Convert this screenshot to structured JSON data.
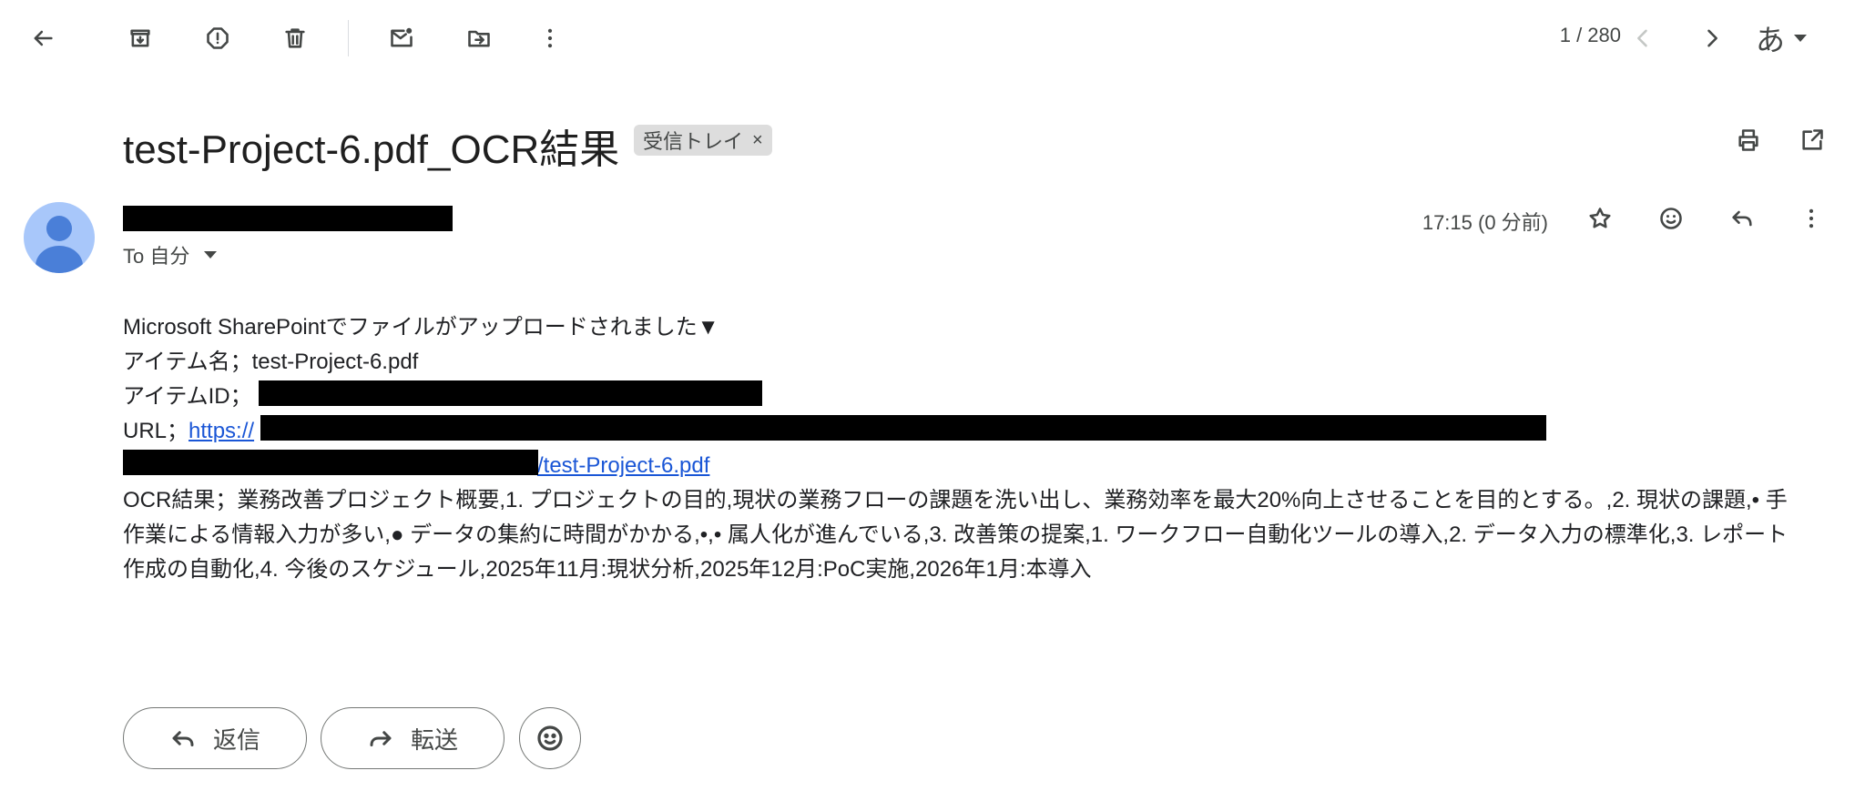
{
  "toolbar": {
    "icons": [
      "back-arrow-icon",
      "archive-icon",
      "report-spam-icon",
      "delete-icon",
      "mark-unread-icon",
      "move-to-icon",
      "more-vert-icon"
    ],
    "pager_text": "1 / 280",
    "lang_label": "あ"
  },
  "email": {
    "subject": "test-Project-6.pdf_OCR結果",
    "label_chip": "受信トレイ",
    "label_chip_remove": "×",
    "to_text": "To 自分",
    "time_text": "17:15 (0 分前)",
    "body": {
      "line1": "Microsoft SharePointでファイルがアップロードされました▼",
      "line2": "アイテム名；test-Project-6.pdf",
      "line3_label": "アイテムID；",
      "line4_label": "URL；",
      "line4_link": "https://",
      "line5_link": "/test-Project-6.pdf",
      "ocr": "OCR結果；業務改善プロジェクト概要,1. プロジェクトの目的,現状の業務フローの課題を洗い出し、業務効率を最大20%向上させることを目的とする。,2. 現状の課題,• 手作業による情報入力が多い,● データの集約に時間がかかる,•,• 属人化が進んでいる,3. 改善策の提案,1. ワークフロー自動化ツールの導入,2. データ入力の標準化,3. レポート作成の自動化,4. 今後のスケジュール,2025年11月:現状分析,2025年12月:PoC実施,2026年1月:本導入"
    }
  },
  "actions": {
    "reply_label": "返信",
    "forward_label": "転送"
  },
  "colors": {
    "link": "#1a56d6",
    "avatar_bg": "#a8c7fa",
    "avatar_fg": "#4a7fd8",
    "chip_bg": "#dddddd"
  }
}
